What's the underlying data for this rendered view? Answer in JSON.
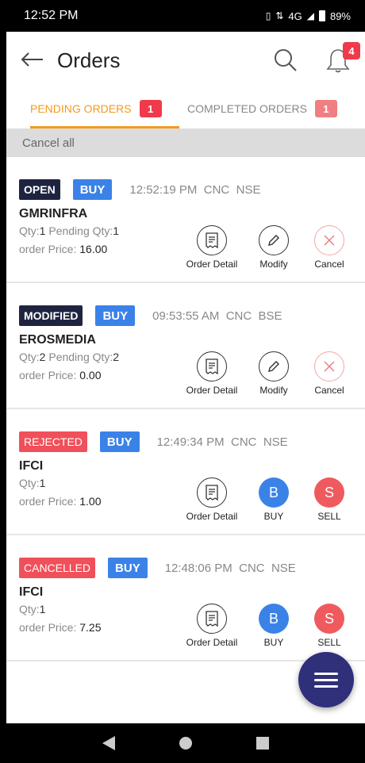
{
  "status_bar": {
    "time": "12:52 PM",
    "network": "4G",
    "battery": "89%"
  },
  "app_bar": {
    "title": "Orders",
    "notification_count": "4"
  },
  "tabs": [
    {
      "label": "PENDING ORDERS",
      "count": "1"
    },
    {
      "label": "COMPLETED ORDERS",
      "count": "1"
    }
  ],
  "cancel_all": "Cancel all",
  "orders": [
    {
      "status": "OPEN",
      "side": "BUY",
      "time": "12:52:19 PM",
      "product": "CNC",
      "exchange": "NSE",
      "symbol": "GMRINFRA",
      "qty_label": "Qty:",
      "qty": "1",
      "pending_label": "Pending Qty:",
      "pending_qty": "1",
      "price_label": "order Price:",
      "price": "16.00",
      "actions": [
        "Order Detail",
        "Modify",
        "Cancel"
      ]
    },
    {
      "status": "MODIFIED",
      "side": "BUY",
      "time": "09:53:55 AM",
      "product": "CNC",
      "exchange": "BSE",
      "symbol": "EROSMEDIA",
      "qty_label": "Qty:",
      "qty": "2",
      "pending_label": "Pending Qty:",
      "pending_qty": "2",
      "price_label": "order Price:",
      "price": "0.00",
      "actions": [
        "Order Detail",
        "Modify",
        "Cancel"
      ]
    },
    {
      "status": "REJECTED",
      "side": "BUY",
      "time": "12:49:34 PM",
      "product": "CNC",
      "exchange": "NSE",
      "symbol": "IFCI",
      "qty_label": "Qty:",
      "qty": "1",
      "price_label": "order Price:",
      "price": "1.00",
      "actions": [
        "Order Detail",
        "BUY",
        "SELL"
      ],
      "buy_glyph": "B",
      "sell_glyph": "S"
    },
    {
      "status": "CANCELLED",
      "side": "BUY",
      "time": "12:48:06 PM",
      "product": "CNC",
      "exchange": "NSE",
      "symbol": "IFCI",
      "qty_label": "Qty:",
      "qty": "1",
      "price_label": "order Price:",
      "price": "7.25",
      "actions": [
        "Order Detail",
        "BUY",
        "SELL"
      ],
      "buy_glyph": "B",
      "sell_glyph": "S"
    }
  ],
  "colors": {
    "accent": "#f29a1e",
    "buy": "#3b82e8",
    "sell": "#ef5a5e",
    "fab": "#2f2f7a",
    "badge": "#f03a4a"
  }
}
